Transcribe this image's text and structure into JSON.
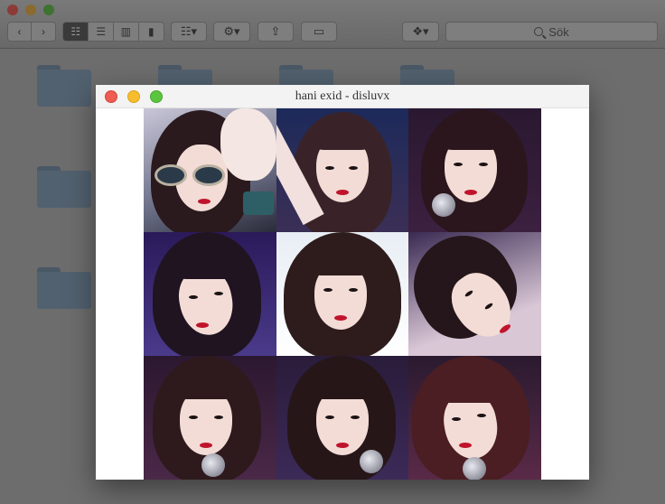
{
  "finder": {
    "search_placeholder": "Sök",
    "icons": [
      "chevron-left-icon",
      "chevron-right-icon",
      "icon-view-icon",
      "list-view-icon",
      "column-view-icon",
      "cover-flow-icon",
      "arrange-icon",
      "gear-icon",
      "share-icon",
      "tag-icon",
      "dropbox-icon",
      "search-icon"
    ]
  },
  "preview": {
    "title": "hani exid - disluvx"
  },
  "colors": {
    "close": "#ee5c52",
    "minimize": "#f7bd2f",
    "zoom": "#5cc53f"
  }
}
